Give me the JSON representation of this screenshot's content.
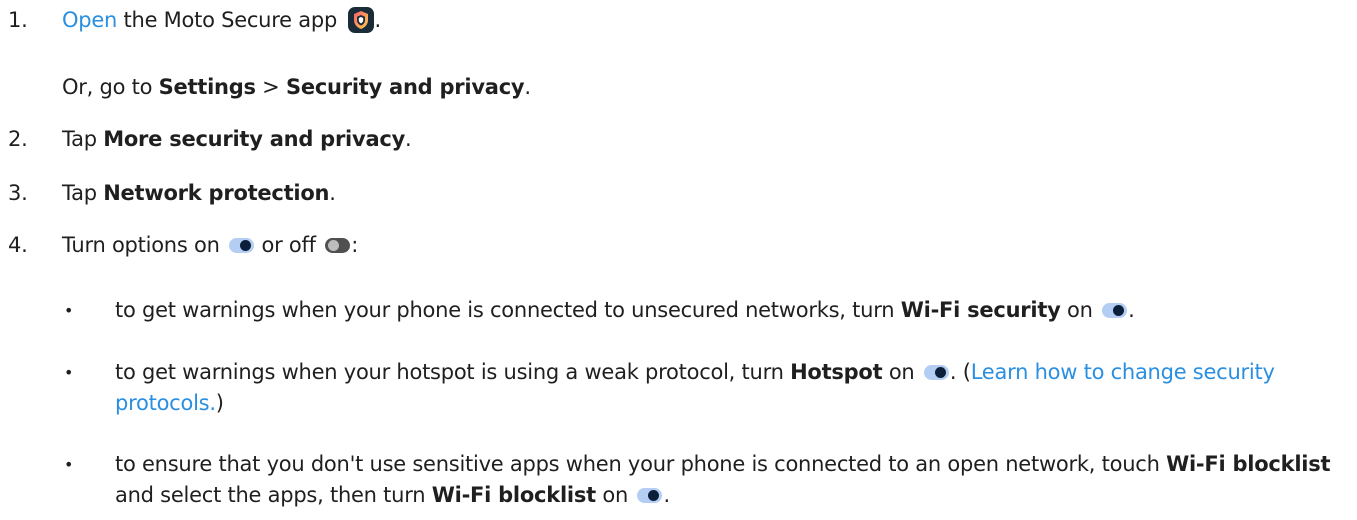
{
  "steps": [
    {
      "num": "1.",
      "link": "Open",
      "text": " the Moto Secure app ",
      "end": "."
    },
    {
      "prefix": "Or, go to ",
      "bold1": "Settings",
      "sep": " > ",
      "bold2": "Security and privacy",
      "end": "."
    },
    {
      "num": "2.",
      "text": "Tap ",
      "bold": "More security and privacy",
      "end": "."
    },
    {
      "num": "3.",
      "text": "Tap ",
      "bold": "Network protection",
      "end": "."
    },
    {
      "num": "4.",
      "t1": "Turn options on ",
      "t2": " or off ",
      "end": ":"
    }
  ],
  "bullets": [
    {
      "dot": "•",
      "t1": "to get warnings when your phone is connected to unsecured networks, turn ",
      "bold": "Wi-Fi security",
      "t2": " on ",
      "end": "."
    },
    {
      "dot": "•",
      "t1": "to get warnings when your hotspot is using a weak protocol, turn ",
      "bold": "Hotspot",
      "t2": " on ",
      "t3": ". (",
      "link": "Learn how to change security protocols.",
      "end": ")"
    },
    {
      "dot": "•",
      "t1": "to ensure that you don't use sensitive apps when your phone is connected to an open network, touch ",
      "bold1": "Wi-Fi blocklist",
      "t2": " and select the apps, then turn ",
      "bold2": "Wi-Fi blocklist",
      "t3": " on ",
      "end": "."
    }
  ],
  "colors": {
    "link": "#2a8fe0",
    "toggle_on_track": "#b4cdf2",
    "toggle_on_knob": "#0c1f3a",
    "toggle_off_track": "#505050",
    "app_icon_bg": "#1a2c38"
  },
  "icons": {
    "app": "moto-secure-shield-icon",
    "toggle_on": "toggle-on-icon",
    "toggle_off": "toggle-off-icon"
  }
}
